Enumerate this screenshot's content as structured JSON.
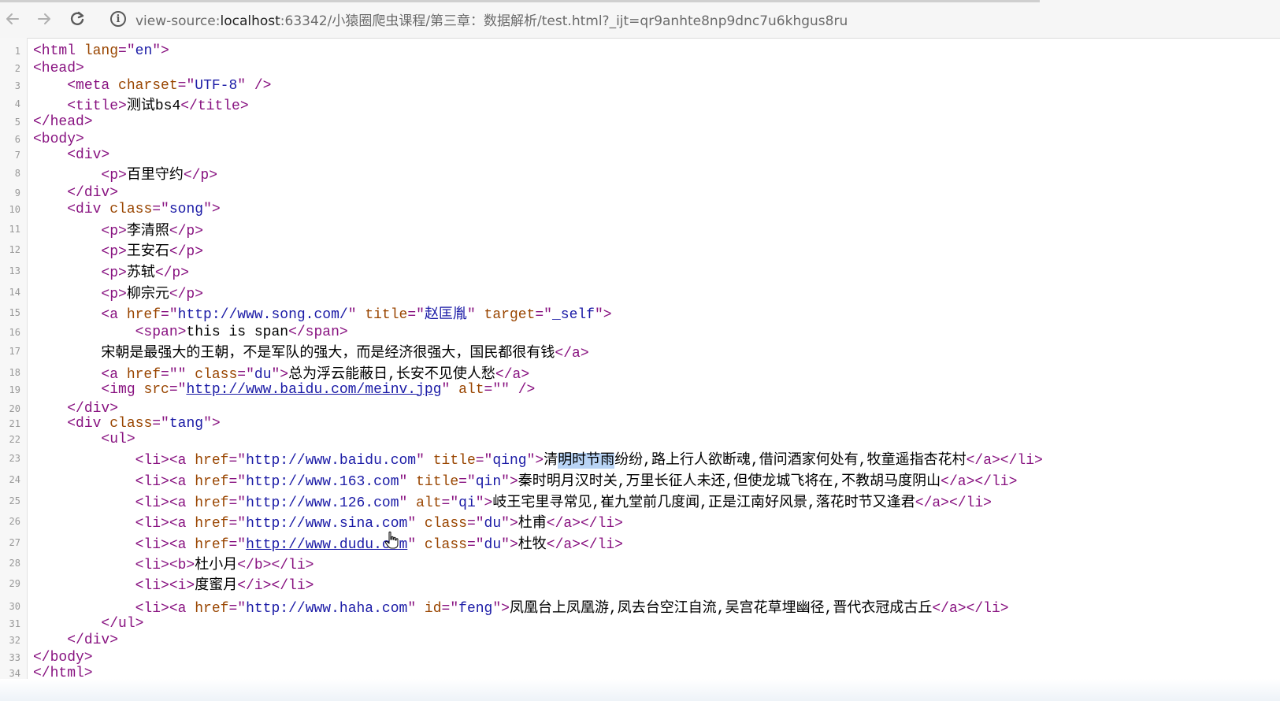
{
  "browser": {
    "info_symbol": "i",
    "url_scheme": "view-source:",
    "url_host": "localhost",
    "url_path": ":63342/小猿圈爬虫课程/第三章：数据解析/test.html?_ijt=qr9anhte8np9dnc7u6khgus8ru",
    "icons": {
      "back": "back-arrow-icon",
      "forward": "forward-arrow-icon",
      "reload": "reload-icon",
      "info": "info-icon"
    }
  },
  "source": {
    "lines": [
      {
        "n": "1",
        "indent": "",
        "parts": [
          [
            "t",
            "<html "
          ],
          [
            "a",
            "lang"
          ],
          [
            "t",
            "=\""
          ],
          [
            "v",
            "en"
          ],
          [
            "t",
            "\">"
          ]
        ]
      },
      {
        "n": "2",
        "indent": "",
        "parts": [
          [
            "t",
            "<head>"
          ]
        ]
      },
      {
        "n": "3",
        "indent": "    ",
        "parts": [
          [
            "t",
            "<meta "
          ],
          [
            "a",
            "charset"
          ],
          [
            "t",
            "=\""
          ],
          [
            "v",
            "UTF-8"
          ],
          [
            "t",
            "\" />"
          ]
        ]
      },
      {
        "n": "4",
        "indent": "    ",
        "parts": [
          [
            "t",
            "<title>"
          ],
          [
            "x",
            "测试bs4"
          ],
          [
            "t",
            "</title>"
          ]
        ]
      },
      {
        "n": "5",
        "indent": "",
        "parts": [
          [
            "t",
            "</head>"
          ]
        ]
      },
      {
        "n": "6",
        "indent": "",
        "parts": [
          [
            "t",
            "<body>"
          ]
        ]
      },
      {
        "n": "7",
        "indent": "    ",
        "parts": [
          [
            "t",
            "<div>"
          ]
        ]
      },
      {
        "n": "8",
        "indent": "        ",
        "parts": [
          [
            "t",
            "<p>"
          ],
          [
            "x",
            "百里守约"
          ],
          [
            "t",
            "</p>"
          ]
        ]
      },
      {
        "n": "9",
        "indent": "    ",
        "parts": [
          [
            "t",
            "</div>"
          ]
        ]
      },
      {
        "n": "10",
        "indent": "    ",
        "parts": [
          [
            "t",
            "<div "
          ],
          [
            "a",
            "class"
          ],
          [
            "t",
            "=\""
          ],
          [
            "v",
            "song"
          ],
          [
            "t",
            "\">"
          ]
        ]
      },
      {
        "n": "11",
        "indent": "        ",
        "parts": [
          [
            "t",
            "<p>"
          ],
          [
            "x",
            "李清照"
          ],
          [
            "t",
            "</p>"
          ]
        ]
      },
      {
        "n": "12",
        "indent": "        ",
        "parts": [
          [
            "t",
            "<p>"
          ],
          [
            "x",
            "王安石"
          ],
          [
            "t",
            "</p>"
          ]
        ]
      },
      {
        "n": "13",
        "indent": "        ",
        "parts": [
          [
            "t",
            "<p>"
          ],
          [
            "x",
            "苏轼"
          ],
          [
            "t",
            "</p>"
          ]
        ]
      },
      {
        "n": "14",
        "indent": "        ",
        "parts": [
          [
            "t",
            "<p>"
          ],
          [
            "x",
            "柳宗元"
          ],
          [
            "t",
            "</p>"
          ]
        ]
      },
      {
        "n": "15",
        "indent": "        ",
        "parts": [
          [
            "t",
            "<a "
          ],
          [
            "a",
            "href"
          ],
          [
            "t",
            "=\""
          ],
          [
            "v",
            "http://www.song.com/"
          ],
          [
            "t",
            "\" "
          ],
          [
            "a",
            "title"
          ],
          [
            "t",
            "=\""
          ],
          [
            "v",
            "赵匡胤"
          ],
          [
            "t",
            "\" "
          ],
          [
            "a",
            "target"
          ],
          [
            "t",
            "=\""
          ],
          [
            "v",
            "_self"
          ],
          [
            "t",
            "\">"
          ]
        ]
      },
      {
        "n": "16",
        "indent": "            ",
        "parts": [
          [
            "t",
            "<span>"
          ],
          [
            "x",
            "this is span"
          ],
          [
            "t",
            "</span>"
          ]
        ]
      },
      {
        "n": "17",
        "indent": "        ",
        "parts": [
          [
            "x",
            "宋朝是最强大的王朝，不是军队的强大，而是经济很强大，国民都很有钱"
          ],
          [
            "t",
            "</a>"
          ]
        ]
      },
      {
        "n": "18",
        "indent": "        ",
        "parts": [
          [
            "t",
            "<a "
          ],
          [
            "a",
            "href"
          ],
          [
            "t",
            "=\"\" "
          ],
          [
            "a",
            "class"
          ],
          [
            "t",
            "=\""
          ],
          [
            "v",
            "du"
          ],
          [
            "t",
            "\">"
          ],
          [
            "x",
            "总为浮云能蔽日,长安不见使人愁"
          ],
          [
            "t",
            "</a>"
          ]
        ]
      },
      {
        "n": "19",
        "indent": "        ",
        "parts": [
          [
            "t",
            "<img "
          ],
          [
            "a",
            "src"
          ],
          [
            "t",
            "=\""
          ],
          [
            "lk",
            "http://www.baidu.com/meinv.jpg"
          ],
          [
            "t",
            "\" "
          ],
          [
            "a",
            "alt"
          ],
          [
            "t",
            "=\"\" />"
          ]
        ]
      },
      {
        "n": "20",
        "indent": "    ",
        "parts": [
          [
            "t",
            "</div>"
          ]
        ]
      },
      {
        "n": "21",
        "indent": "    ",
        "parts": [
          [
            "t",
            "<div "
          ],
          [
            "a",
            "class"
          ],
          [
            "t",
            "=\""
          ],
          [
            "v",
            "tang"
          ],
          [
            "t",
            "\">"
          ]
        ]
      },
      {
        "n": "22",
        "indent": "        ",
        "parts": [
          [
            "t",
            "<ul>"
          ]
        ]
      },
      {
        "n": "23",
        "indent": "            ",
        "parts": [
          [
            "t",
            "<li><a "
          ],
          [
            "a",
            "href"
          ],
          [
            "t",
            "=\""
          ],
          [
            "v",
            "http://www.baidu.com"
          ],
          [
            "t",
            "\" "
          ],
          [
            "a",
            "title"
          ],
          [
            "t",
            "=\""
          ],
          [
            "v",
            "qing"
          ],
          [
            "t",
            "\">"
          ],
          [
            "x",
            "清"
          ],
          [
            "hl",
            "明时节雨"
          ],
          [
            "x",
            "纷纷,路上行人欲断魂,借问酒家何处有,牧童遥指杏花村"
          ],
          [
            "t",
            "</a></li>"
          ]
        ]
      },
      {
        "n": "24",
        "indent": "            ",
        "parts": [
          [
            "t",
            "<li><a "
          ],
          [
            "a",
            "href"
          ],
          [
            "t",
            "=\""
          ],
          [
            "v",
            "http://www.163.com"
          ],
          [
            "t",
            "\" "
          ],
          [
            "a",
            "title"
          ],
          [
            "t",
            "=\""
          ],
          [
            "v",
            "qin"
          ],
          [
            "t",
            "\">"
          ],
          [
            "x",
            "秦时明月汉时关,万里长征人未还,但使龙城飞将在,不教胡马度阴山"
          ],
          [
            "t",
            "</a></li>"
          ]
        ]
      },
      {
        "n": "25",
        "indent": "            ",
        "parts": [
          [
            "t",
            "<li><a "
          ],
          [
            "a",
            "href"
          ],
          [
            "t",
            "=\""
          ],
          [
            "v",
            "http://www.126.com"
          ],
          [
            "t",
            "\" "
          ],
          [
            "a",
            "alt"
          ],
          [
            "t",
            "=\""
          ],
          [
            "v",
            "qi"
          ],
          [
            "t",
            "\">"
          ],
          [
            "x",
            "岐王宅里寻常见,崔九堂前几度闻,正是江南好风景,落花时节又逢君"
          ],
          [
            "t",
            "</a></li>"
          ]
        ]
      },
      {
        "n": "26",
        "indent": "            ",
        "parts": [
          [
            "t",
            "<li><a "
          ],
          [
            "a",
            "href"
          ],
          [
            "t",
            "=\""
          ],
          [
            "v",
            "http://www.sina.com"
          ],
          [
            "t",
            "\" "
          ],
          [
            "a",
            "class"
          ],
          [
            "t",
            "=\""
          ],
          [
            "v",
            "du"
          ],
          [
            "t",
            "\">"
          ],
          [
            "x",
            "杜甫"
          ],
          [
            "t",
            "</a></li>"
          ]
        ]
      },
      {
        "n": "27",
        "indent": "            ",
        "parts": [
          [
            "t",
            "<li><a "
          ],
          [
            "a",
            "href"
          ],
          [
            "t",
            "=\""
          ],
          [
            "lk",
            "http://www.dudu.com"
          ],
          [
            "t",
            "\" "
          ],
          [
            "a",
            "class"
          ],
          [
            "t",
            "=\""
          ],
          [
            "v",
            "du"
          ],
          [
            "t",
            "\">"
          ],
          [
            "x",
            "杜牧"
          ],
          [
            "t",
            "</a></li>"
          ]
        ]
      },
      {
        "n": "28",
        "indent": "            ",
        "parts": [
          [
            "t",
            "<li><b>"
          ],
          [
            "x",
            "杜小月"
          ],
          [
            "t",
            "</b></li>"
          ]
        ]
      },
      {
        "n": "29",
        "indent": "            ",
        "parts": [
          [
            "t",
            "<li><i>"
          ],
          [
            "x",
            "度蜜月"
          ],
          [
            "t",
            "</i></li>"
          ]
        ]
      },
      {
        "n": "30",
        "indent": "            ",
        "parts": [
          [
            "t",
            "<li><a "
          ],
          [
            "a",
            "href"
          ],
          [
            "t",
            "=\""
          ],
          [
            "v",
            "http://www.haha.com"
          ],
          [
            "t",
            "\" "
          ],
          [
            "a",
            "id"
          ],
          [
            "t",
            "=\""
          ],
          [
            "v",
            "feng"
          ],
          [
            "t",
            "\">"
          ],
          [
            "x",
            "凤凰台上凤凰游,凤去台空江自流,吴宫花草埋幽径,晋代衣冠成古丘"
          ],
          [
            "t",
            "</a></li>"
          ]
        ]
      },
      {
        "n": "31",
        "indent": "        ",
        "parts": [
          [
            "t",
            "</ul>"
          ]
        ]
      },
      {
        "n": "32",
        "indent": "    ",
        "parts": [
          [
            "t",
            "</div>"
          ]
        ]
      },
      {
        "n": "33",
        "indent": "",
        "parts": [
          [
            "t",
            "</body>"
          ]
        ]
      },
      {
        "n": "34",
        "indent": "",
        "parts": [
          [
            "t",
            "</html>"
          ]
        ]
      }
    ]
  },
  "colors": {
    "tag": "#881280",
    "attr": "#994500",
    "value": "#1a1aa6",
    "selection": "#b9d4f5"
  }
}
